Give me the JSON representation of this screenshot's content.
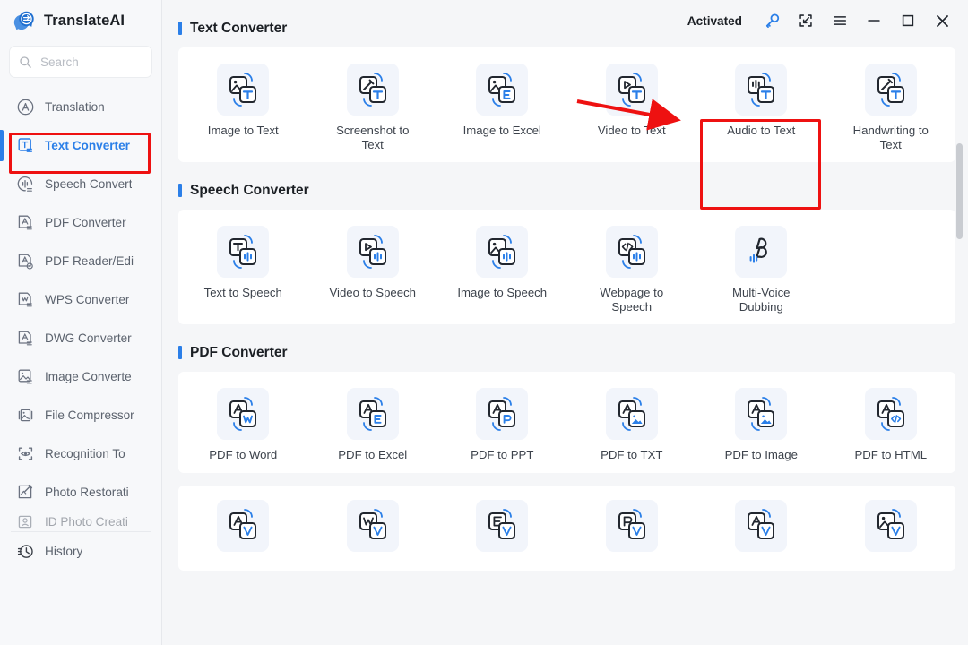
{
  "app": {
    "name": "TranslateAI",
    "logo_icon": "translate-chat-logo"
  },
  "search": {
    "placeholder": "Search",
    "icon": "search-icon"
  },
  "titlebar": {
    "activated_label": "Activated",
    "buttons": [
      {
        "name": "key-icon",
        "label": ""
      },
      {
        "name": "shrink-icon",
        "label": ""
      },
      {
        "name": "menu-icon",
        "label": ""
      },
      {
        "name": "minimize-icon",
        "label": ""
      },
      {
        "name": "maximize-icon",
        "label": ""
      },
      {
        "name": "close-icon",
        "label": ""
      }
    ]
  },
  "sidebar": {
    "items": [
      {
        "label": "Translation",
        "icon": "translation-icon",
        "active": false
      },
      {
        "label": "Text Converter",
        "icon": "text-converter-icon",
        "active": true
      },
      {
        "label": "Speech Convert",
        "icon": "speech-convert-icon",
        "active": false
      },
      {
        "label": "PDF Converter",
        "icon": "pdf-converter-icon",
        "active": false
      },
      {
        "label": "PDF Reader/Edi",
        "icon": "pdf-reader-icon",
        "active": false
      },
      {
        "label": "WPS Converter",
        "icon": "wps-converter-icon",
        "active": false
      },
      {
        "label": "DWG Converter",
        "icon": "dwg-converter-icon",
        "active": false
      },
      {
        "label": "Image Converte",
        "icon": "image-converter-icon",
        "active": false
      },
      {
        "label": "File Compressor",
        "icon": "file-compressor-icon",
        "active": false
      },
      {
        "label": "Recognition To",
        "icon": "recognition-icon",
        "active": false
      },
      {
        "label": "Photo Restorati",
        "icon": "photo-restoration-icon",
        "active": false
      },
      {
        "label": "ID Photo Creati",
        "icon": "id-photo-icon",
        "active": false
      }
    ],
    "footer": {
      "label": "History",
      "icon": "history-icon"
    }
  },
  "sections": [
    {
      "title": "Text Converter",
      "tiles": [
        {
          "label": "Image to Text",
          "icon": "image-to-text-icon",
          "highlighted": false
        },
        {
          "label": "Screenshot to Text",
          "icon": "screenshot-to-text-icon",
          "highlighted": false
        },
        {
          "label": "Image to Excel",
          "icon": "image-to-excel-icon",
          "highlighted": false
        },
        {
          "label": "Video to Text",
          "icon": "video-to-text-icon",
          "highlighted": false
        },
        {
          "label": "Audio to Text",
          "icon": "audio-to-text-icon",
          "highlighted": true
        },
        {
          "label": "Handwriting to Text",
          "icon": "handwriting-to-text-icon",
          "highlighted": false
        }
      ]
    },
    {
      "title": "Speech Converter",
      "tiles": [
        {
          "label": "Text to Speech",
          "icon": "text-to-speech-icon",
          "highlighted": false
        },
        {
          "label": "Video to Speech",
          "icon": "video-to-speech-icon",
          "highlighted": false
        },
        {
          "label": "Image to Speech",
          "icon": "image-to-speech-icon",
          "highlighted": false
        },
        {
          "label": "Webpage to Speech",
          "icon": "webpage-to-speech-icon",
          "highlighted": false
        },
        {
          "label": "Multi-Voice Dubbing",
          "icon": "multi-voice-dubbing-icon",
          "highlighted": false
        }
      ]
    },
    {
      "title": "PDF Converter",
      "tiles": [
        {
          "label": "PDF to Word",
          "icon": "pdf-to-word-icon",
          "highlighted": false
        },
        {
          "label": "PDF to Excel",
          "icon": "pdf-to-excel-icon",
          "highlighted": false
        },
        {
          "label": "PDF to PPT",
          "icon": "pdf-to-ppt-icon",
          "highlighted": false
        },
        {
          "label": "PDF to TXT",
          "icon": "pdf-to-txt-icon",
          "highlighted": false
        },
        {
          "label": "PDF to Image",
          "icon": "pdf-to-image-icon",
          "highlighted": false
        },
        {
          "label": "PDF to HTML",
          "icon": "pdf-to-html-icon",
          "highlighted": false
        }
      ]
    },
    {
      "title": "",
      "partial": true,
      "tiles": [
        {
          "label": "",
          "icon": "word-to-pdf-icon",
          "highlighted": false
        },
        {
          "label": "",
          "icon": "wps-to-pdf-icon",
          "highlighted": false
        },
        {
          "label": "",
          "icon": "excel-to-pdf-icon",
          "highlighted": false
        },
        {
          "label": "",
          "icon": "ppt-to-pdf-icon",
          "highlighted": false
        },
        {
          "label": "",
          "icon": "txt-to-pdf-icon",
          "highlighted": false
        },
        {
          "label": "",
          "icon": "image-to-pdf-icon",
          "highlighted": false
        }
      ]
    }
  ],
  "annotations": {
    "highlight_color": "#ee1111",
    "arrow_color": "#ee1111",
    "highlight_targets": [
      "Text Converter",
      "Audio to Text"
    ]
  },
  "colors": {
    "accent": "#2b7fe8",
    "sidebar_bg": "#f7f8fa",
    "main_bg": "#f5f6f8",
    "card_bg": "#ffffff",
    "tile_icon_bg": "#f2f5fb"
  }
}
